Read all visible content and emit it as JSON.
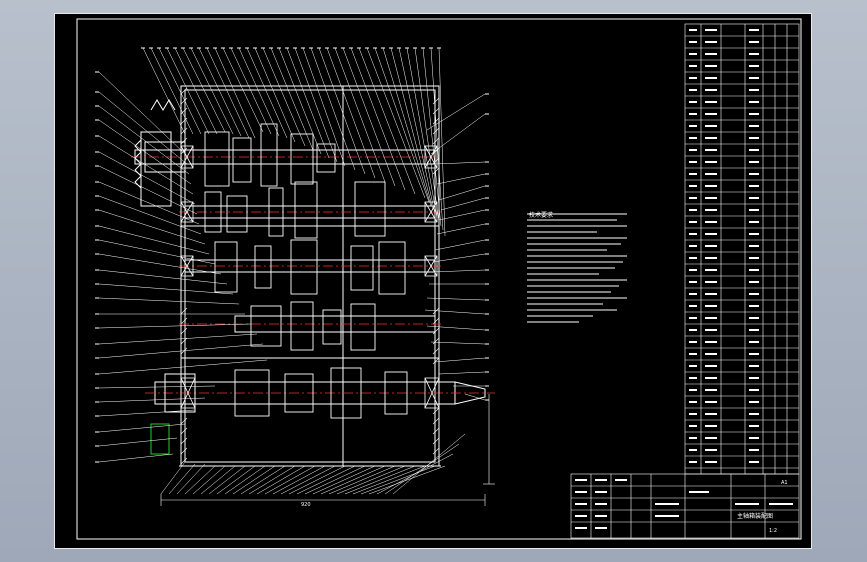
{
  "drawing": {
    "notes_title": "技术要求",
    "bottom_dimension": "920",
    "title_block": {
      "name": "主轴箱装配图",
      "scale": "1:2",
      "sheet_label": "A1"
    },
    "colors": {
      "background": "#000000",
      "lines": "#ffffff",
      "centerlines": "#ff2a2a",
      "green": "#22cc22",
      "desktop": "#aab3c2"
    }
  }
}
